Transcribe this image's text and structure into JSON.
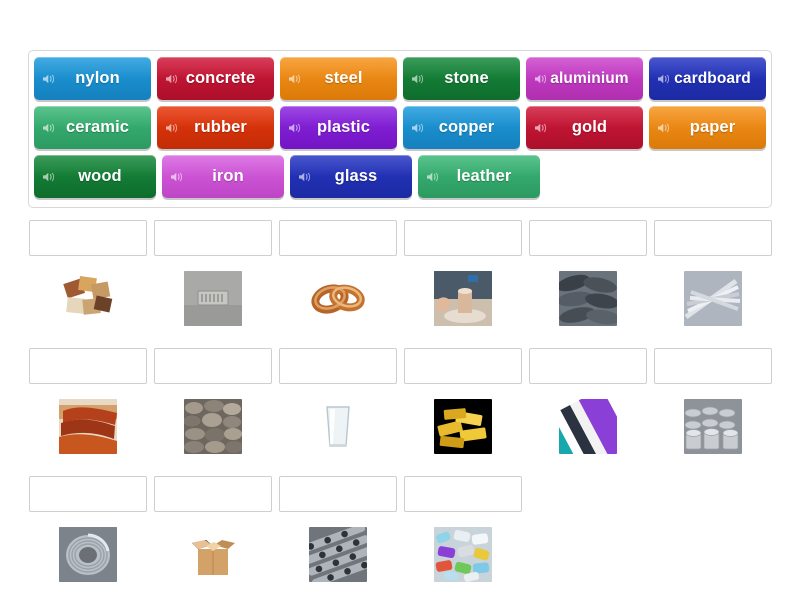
{
  "activity": {
    "type": "match-up",
    "title": "Materials match-up"
  },
  "word_bank": {
    "icon": "speaker-icon",
    "rows": [
      [
        {
          "label": "nylon",
          "color": "#1f9bdd",
          "dark": "#1580bd"
        },
        {
          "label": "concrete",
          "color": "#d11a3a",
          "dark": "#ad0f2b"
        },
        {
          "label": "steel",
          "color": "#f7941e",
          "dark": "#dc7a09"
        },
        {
          "label": "stone",
          "color": "#178a3c",
          "dark": "#0f6d2d"
        },
        {
          "label": "aluminium",
          "color": "#cc44cc",
          "dark": "#b02eb0"
        },
        {
          "label": "cardboard",
          "color": "#2737c4",
          "dark": "#1c2aa3"
        }
      ],
      [
        {
          "label": "ceramic",
          "color": "#3cb878",
          "dark": "#2c9a61"
        },
        {
          "label": "rubber",
          "color": "#e8380d",
          "dark": "#c22c07"
        },
        {
          "label": "plastic",
          "color": "#8b26e0",
          "dark": "#7315c4"
        },
        {
          "label": "copper",
          "color": "#1f9bdd",
          "dark": "#1580bd"
        },
        {
          "label": "gold",
          "color": "#d11a3a",
          "dark": "#ad0f2b"
        },
        {
          "label": "paper",
          "color": "#f7941e",
          "dark": "#dc7a09"
        }
      ],
      [
        {
          "label": "wood",
          "color": "#178a3c",
          "dark": "#0f6d2d"
        },
        {
          "label": "iron",
          "color": "#d861e0",
          "dark": "#bf45c7"
        },
        {
          "label": "glass",
          "color": "#2737c4",
          "dark": "#1c2aa3"
        },
        {
          "label": "leather",
          "color": "#3cb878",
          "dark": "#2c9a61"
        }
      ]
    ]
  },
  "answer_grid": {
    "dropzone_value": "",
    "rows": [
      [
        {
          "image": "wood-blocks-photo",
          "answer": ""
        },
        {
          "image": "concrete-slab-photo",
          "answer": ""
        },
        {
          "image": "copper-coils-photo",
          "answer": ""
        },
        {
          "image": "ceramic-pottery-photo",
          "answer": ""
        },
        {
          "image": "rubber-tyres-photo",
          "answer": ""
        },
        {
          "image": "paper-stack-photo",
          "answer": ""
        }
      ],
      [
        {
          "image": "leather-hide-photo",
          "answer": ""
        },
        {
          "image": "stone-wall-photo",
          "answer": ""
        },
        {
          "image": "glass-tumbler-photo",
          "answer": ""
        },
        {
          "image": "gold-bars-photo",
          "answer": ""
        },
        {
          "image": "nylon-fabric-photo",
          "answer": ""
        },
        {
          "image": "aluminium-cans-photo",
          "answer": ""
        }
      ],
      [
        {
          "image": "iron-wire-coil-photo",
          "answer": ""
        },
        {
          "image": "cardboard-box-photo",
          "answer": ""
        },
        {
          "image": "steel-pipes-photo",
          "answer": ""
        },
        {
          "image": "plastic-bottles-photo",
          "answer": ""
        }
      ]
    ]
  }
}
